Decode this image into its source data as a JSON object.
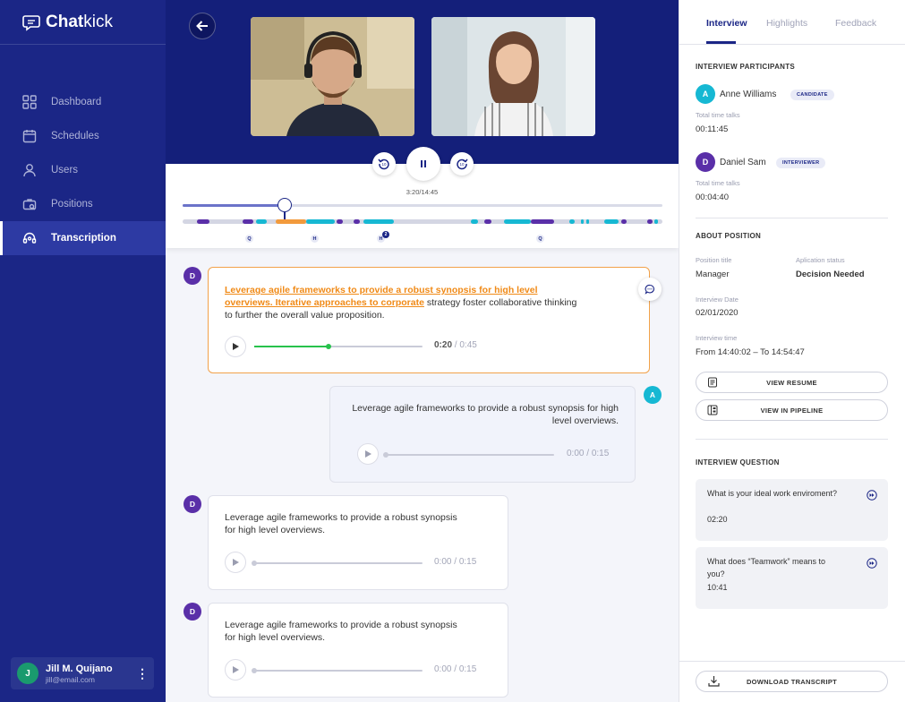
{
  "app": {
    "brand_bold": "Chat",
    "brand_light": "kick"
  },
  "sidebar": {
    "items": [
      {
        "label": "Dashboard",
        "icon": "grid-icon"
      },
      {
        "label": "Schedules",
        "icon": "calendar-icon"
      },
      {
        "label": "Users",
        "icon": "user-icon"
      },
      {
        "label": "Positions",
        "icon": "briefcase-search-icon"
      },
      {
        "label": "Transcription",
        "icon": "headset-icon",
        "active": true
      }
    ],
    "user": {
      "initial": "J",
      "name": "Jill M. Quijano",
      "email": "jill@email.com"
    }
  },
  "player": {
    "time": "3:20/14:45",
    "progress": 0.213,
    "markers": [
      {
        "label": "Q",
        "pos": 0.138
      },
      {
        "label": "H",
        "pos": 0.275
      },
      {
        "label": "H",
        "pos": 0.412,
        "badge": "2"
      },
      {
        "label": "Q",
        "pos": 0.745
      }
    ]
  },
  "chat": {
    "messages": [
      {
        "speaker": "D",
        "highlight": "Leverage agile frameworks to provide a robust synopsis for high level overviews. Iterative approaches to corporate",
        "rest": " strategy foster collaborative thinking to further the overall value proposition.",
        "current": "0:20",
        "total": "0:45",
        "progress": 0.44
      },
      {
        "speaker": "A",
        "text": "Leverage agile frameworks to provide a robust synopsis for high level overviews.",
        "current": "0:00",
        "total": "0:15"
      },
      {
        "speaker": "D",
        "text": "Leverage agile frameworks to provide a robust synopsis for high level overviews.",
        "current": "0:00",
        "total": "0:15"
      },
      {
        "speaker": "D",
        "text": "Leverage agile frameworks to provide a robust synopsis for high level overviews.",
        "current": "0:00",
        "total": "0:15"
      }
    ],
    "separator": "/"
  },
  "right": {
    "tabs": [
      "Interview",
      "Highlights",
      "Feedback"
    ],
    "participants_title": "INTERVIEW PARTICIPANTS",
    "participants": [
      {
        "initial": "A",
        "name": "Anne Williams",
        "role": "CANDIDATE",
        "time_label": "Total time talks",
        "time": "00:11:45",
        "color": "#16b8d3"
      },
      {
        "initial": "D",
        "name": "Daniel Sam",
        "role": "INTERVIEWER",
        "time_label": "Total time talks",
        "time": "00:04:40",
        "color": "#5a2fa8"
      }
    ],
    "position_title": "ABOUT POSITION",
    "position": {
      "title_label": "Position title",
      "title": "Manager",
      "status_label": "Aplication status",
      "status": "Decision Needed",
      "date_label": "Interview Date",
      "date": "02/01/2020",
      "time_label": "Interview time",
      "time": "From 14:40:02 – To 14:54:47"
    },
    "buttons": {
      "resume": "VIEW RESUME",
      "pipeline": "VIEW IN PIPELINE"
    },
    "questions_title": "INTERVIEW QUESTION",
    "questions": [
      {
        "text": "What is your ideal work enviroment?",
        "time": "02:20"
      },
      {
        "text": "What does “Teamwork” means to you?",
        "time": "10:41"
      }
    ],
    "download": "DOWNLOAD TRANSCRIPT"
  },
  "colors": {
    "sidebar": "#1b2686",
    "accent": "#1b2686",
    "highlight": "#f08a17",
    "candidate": "#16b8d3",
    "interviewer": "#5a2fa8",
    "audio": "#27c24c"
  }
}
